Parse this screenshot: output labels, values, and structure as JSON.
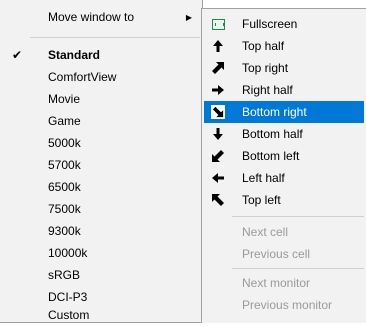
{
  "main_menu": {
    "move_window_label": "Move window to",
    "items": [
      {
        "label": "Standard",
        "checked": true
      },
      {
        "label": "ComfortView",
        "checked": false
      },
      {
        "label": "Movie",
        "checked": false
      },
      {
        "label": "Game",
        "checked": false
      },
      {
        "label": "5000k",
        "checked": false
      },
      {
        "label": "5700k",
        "checked": false
      },
      {
        "label": "6500k",
        "checked": false
      },
      {
        "label": "7500k",
        "checked": false
      },
      {
        "label": "9300k",
        "checked": false
      },
      {
        "label": "10000k",
        "checked": false
      },
      {
        "label": "sRGB",
        "checked": false
      },
      {
        "label": "DCI-P3",
        "checked": false
      },
      {
        "label": "Custom",
        "checked": false
      }
    ],
    "check_glyph": "✔",
    "submenu_arrow": "▶"
  },
  "sub_menu": {
    "items": [
      {
        "label": "Fullscreen",
        "icon": "fullscreen-icon"
      },
      {
        "label": "Top half",
        "icon": "arrow-up-icon",
        "glyph": "🡑"
      },
      {
        "label": "Top right",
        "icon": "arrow-up-right-icon",
        "glyph": "🡕"
      },
      {
        "label": "Right half",
        "icon": "arrow-right-icon",
        "glyph": "🡒"
      },
      {
        "label": "Bottom right",
        "icon": "arrow-down-right-icon",
        "glyph": "🡖",
        "highlighted": true
      },
      {
        "label": "Bottom half",
        "icon": "arrow-down-icon",
        "glyph": "🡓"
      },
      {
        "label": "Bottom left",
        "icon": "arrow-down-left-icon",
        "glyph": "🡗"
      },
      {
        "label": "Left half",
        "icon": "arrow-left-icon",
        "glyph": "🡐"
      },
      {
        "label": "Top left",
        "icon": "arrow-up-left-icon",
        "glyph": "🡔"
      }
    ],
    "cell_items": [
      {
        "label": "Next cell",
        "disabled": true
      },
      {
        "label": "Previous cell",
        "disabled": true
      }
    ],
    "monitor_items": [
      {
        "label": "Next monitor",
        "disabled": true
      },
      {
        "label": "Previous monitor",
        "disabled": true
      }
    ]
  },
  "colors": {
    "menu_bg": "#f2f2f2",
    "highlight": "#0078d7",
    "disabled_text": "#9a9a9a"
  }
}
